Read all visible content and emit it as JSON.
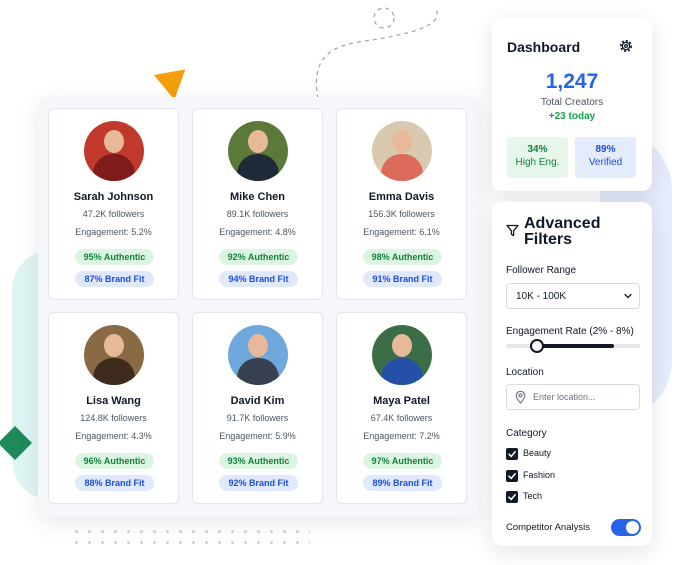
{
  "creators": [
    {
      "name": "Sarah Johnson",
      "followers": "47.2K followers",
      "engagement": "Engagement: 5.2%",
      "authentic": "95% Authentic",
      "brand_fit": "87% Brand Fit",
      "avatar_bg": "#c0392b",
      "outfit": "#7f1d1d"
    },
    {
      "name": "Mike Chen",
      "followers": "89.1K followers",
      "engagement": "Engagement: 4.8%",
      "authentic": "92% Authentic",
      "brand_fit": "94% Brand Fit",
      "avatar_bg": "#5b7a3a",
      "outfit": "#1f2937"
    },
    {
      "name": "Emma Davis",
      "followers": "156.3K followers",
      "engagement": "Engagement: 6.1%",
      "authentic": "98% Authentic",
      "brand_fit": "91% Brand Fit",
      "avatar_bg": "#d9c9b0",
      "outfit": "#dc6b5b"
    },
    {
      "name": "Lisa Wang",
      "followers": "124.8K followers",
      "engagement": "Engagement: 4.3%",
      "authentic": "96% Authentic",
      "brand_fit": "88% Brand Fit",
      "avatar_bg": "#8a6a45",
      "outfit": "#3f2a1e"
    },
    {
      "name": "David Kim",
      "followers": "91.7K followers",
      "engagement": "Engagement: 5.9%",
      "authentic": "93% Authentic",
      "brand_fit": "92% Brand Fit",
      "avatar_bg": "#6fa8dc",
      "outfit": "#374151"
    },
    {
      "name": "Maya Patel",
      "followers": "67.4K followers",
      "engagement": "Engagement: 7.2%",
      "authentic": "97% Authentic",
      "brand_fit": "89% Brand Fit",
      "avatar_bg": "#3b6e46",
      "outfit": "#2450a8"
    }
  ],
  "dashboard": {
    "title": "Dashboard",
    "total": "1,247",
    "total_label": "Total Creators",
    "delta": "+23 today",
    "stats": [
      {
        "value": "34%",
        "label": "High Eng."
      },
      {
        "value": "89%",
        "label": "Verified"
      }
    ]
  },
  "filters": {
    "title": "Advanced Filters",
    "follower_range_label": "Follower Range",
    "follower_range_value": "10K - 100K",
    "engagement_label": "Engagement Rate (2% - 8%)",
    "engagement_min": 2,
    "engagement_max": 8,
    "location_label": "Location",
    "location_placeholder": "Enter location...",
    "category_label": "Category",
    "categories": [
      {
        "label": "Beauty",
        "checked": true
      },
      {
        "label": "Fashion",
        "checked": true
      },
      {
        "label": "Tech",
        "checked": true
      }
    ],
    "competitor_label": "Competitor Analysis",
    "competitor_enabled": true
  },
  "colors": {
    "accent_blue": "#2563eb",
    "accent_green": "#16a34a",
    "deco_orange": "#f59e0b",
    "deco_green": "#1e8a5a"
  }
}
